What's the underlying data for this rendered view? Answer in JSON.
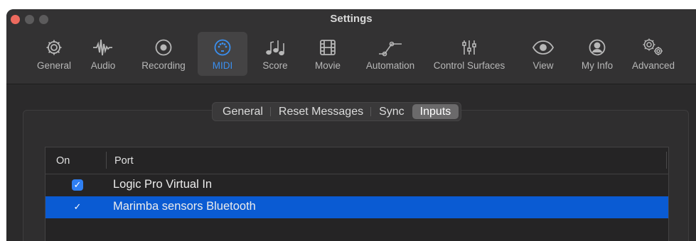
{
  "window": {
    "title": "Settings"
  },
  "toolbar": {
    "selected": "MIDI",
    "accent_color": "#3a8ff0",
    "items": [
      {
        "label": "General",
        "icon": "gear-icon"
      },
      {
        "label": "Audio",
        "icon": "waveform-icon"
      },
      {
        "label": "Recording",
        "icon": "record-icon"
      },
      {
        "label": "MIDI",
        "icon": "midi-port-icon"
      },
      {
        "label": "Score",
        "icon": "music-notes-icon"
      },
      {
        "label": "Movie",
        "icon": "film-icon"
      },
      {
        "label": "Automation",
        "icon": "automation-curve-icon"
      },
      {
        "label": "Control Surfaces",
        "icon": "sliders-icon"
      },
      {
        "label": "View",
        "icon": "eye-icon"
      },
      {
        "label": "My Info",
        "icon": "person-circle-icon"
      },
      {
        "label": "Advanced",
        "icon": "gears-icon"
      }
    ]
  },
  "tabs": {
    "selected": "Inputs",
    "items": [
      "General",
      "Reset Messages",
      "Sync",
      "Inputs"
    ]
  },
  "table": {
    "columns": {
      "on": "On",
      "port": "Port"
    },
    "rows": [
      {
        "on": true,
        "port": "Logic Pro Virtual In",
        "selected": false
      },
      {
        "on": true,
        "port": "Marimba sensors Bluetooth",
        "selected": true
      }
    ],
    "selection_color": "#0a5bd3"
  }
}
